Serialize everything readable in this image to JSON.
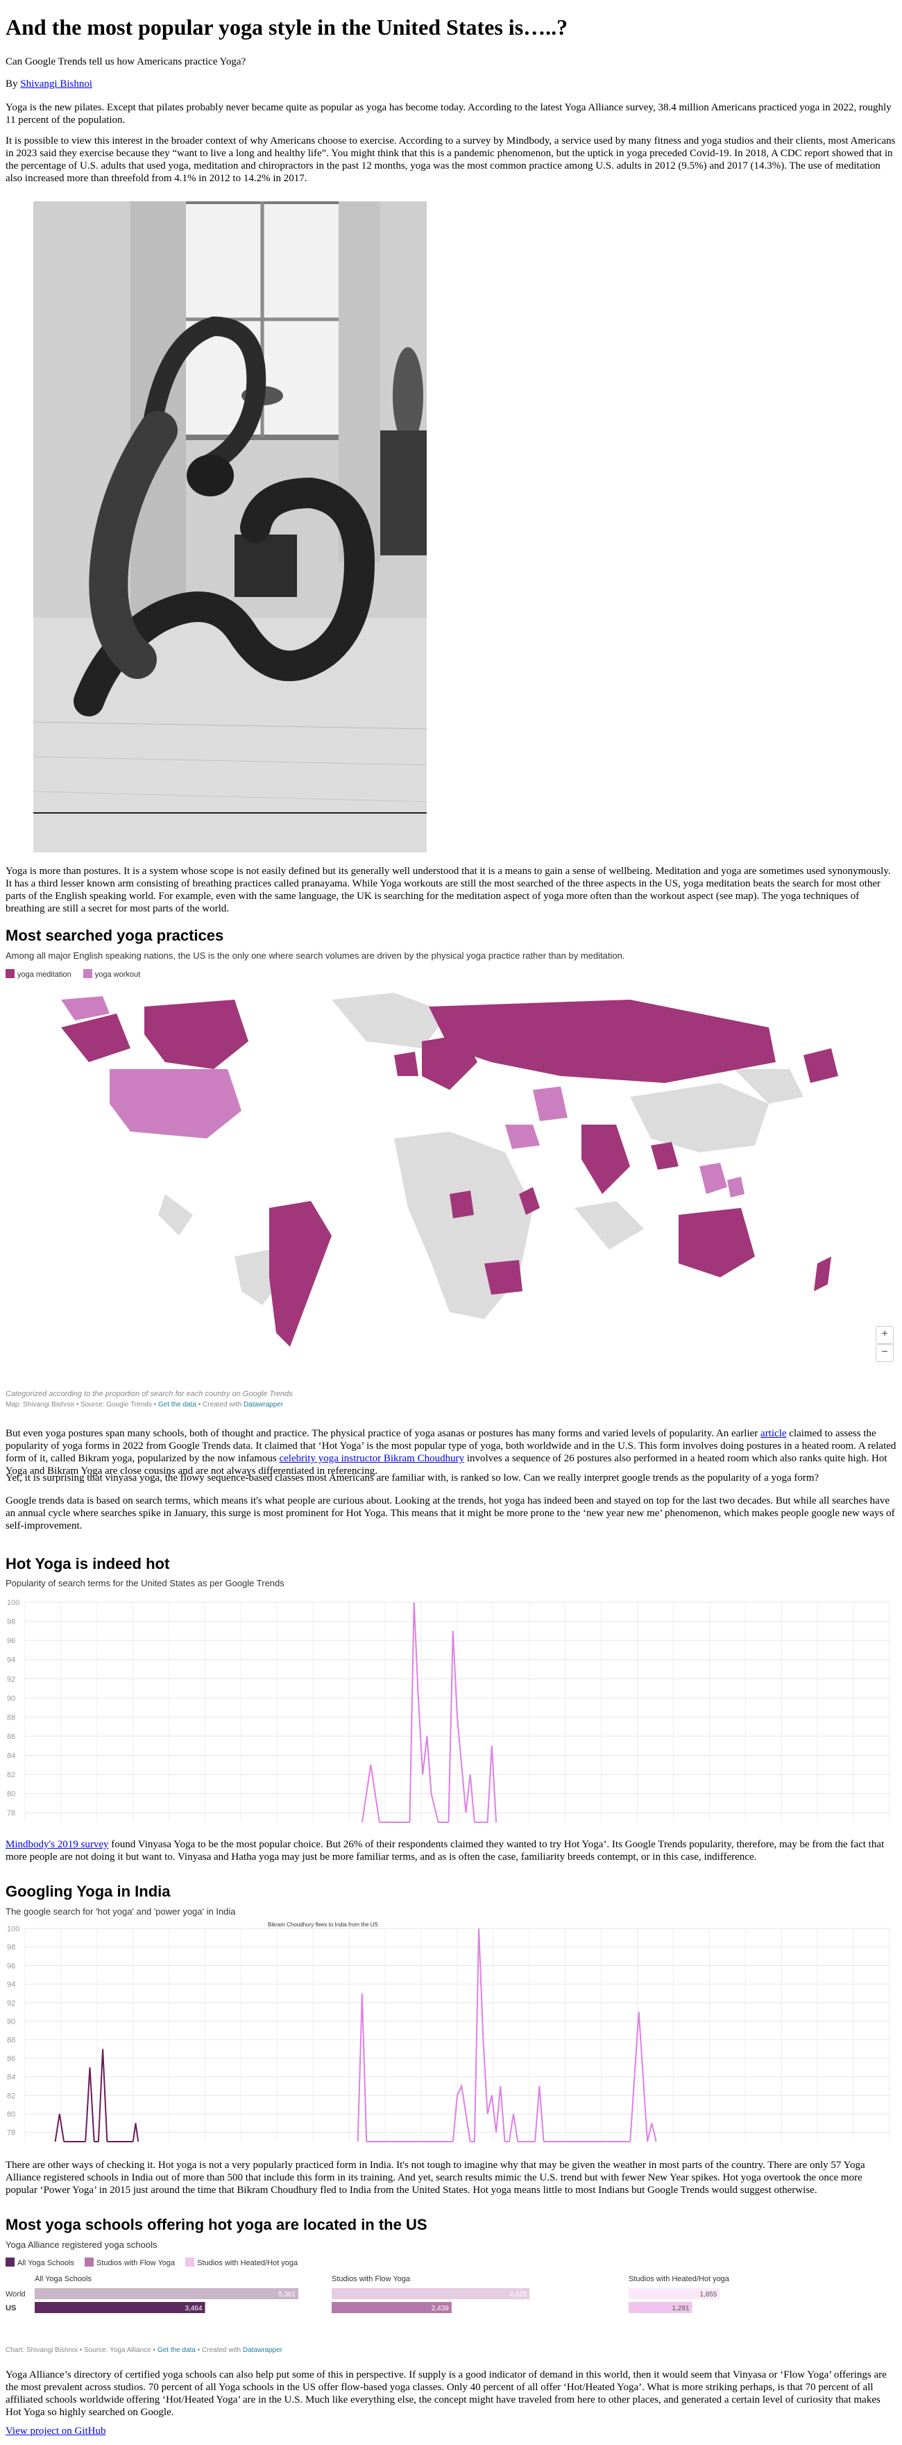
{
  "article": {
    "title": "And the most popular yoga style in the United States is…..?",
    "subtitle": "Can Google Trends tell us how Americans practice Yoga?",
    "byline_prefix": "By ",
    "author": "Shivangi Bishnoi",
    "para1": "Yoga is the new pilates. Except that pilates probably never became quite as popular as yoga has become today. According to the latest Yoga Alliance survey, 38.4 million Americans practiced yoga in 2022, roughly 11 percent of the population.",
    "para2": "It is possible to view this interest in the broader context of why Americans choose to exercise. According to a survey by Mindbody, a service used by many fitness and yoga studios and their clients, most Americans in 2023 said they exercise because they “want to live a long and healthy life”. You might think that this is a pandemic phenomenon, but the uptick in yoga preceded Covid-19. In 2018, A CDC report showed that in the percentage of U.S. adults that used yoga, meditation and chiropractors in the past 12 months, yoga was the most common practice among U.S. adults in 2012 (9.5%) and 2017 (14.3%). The use of meditation also increased more than threefold from 4.1% in 2012 to 14.2% in 2017.",
    "para3": "Yoga is more than postures. It is a system whose scope is not easily defined but its generally well understood that it is a means to gain a sense of wellbeing. Meditation and yoga are sometimes used synonymously. It has a third lesser known arm consisting of breathing practices called pranayama. While Yoga workouts are still the most searched of the three aspects in the US, yoga meditation beats the search for most other parts of the English speaking world. For example, even with the same language, the UK is searching for the meditation aspect of yoga more often than the workout aspect (see map). The yoga techniques of breathing are still a secret for most parts of the world.",
    "para4_a": "But even yoga postures span many schools, both of thought and practice. The physical practice of yoga asanas or postures has many forms and varied levels of popularity. An earlier ",
    "para4_link1": "article",
    "para4_b": " claimed to assess the popularity of yoga forms in 2022 from Google Trends data. It claimed that ‘Hot Yoga’ is the most popular type of yoga, both worldwide and in the U.S. This form involves doing postures in a heated room. A related form of it, called Bikram yoga, popularized by the now infamous ",
    "para4_link2": "celebrity yoga instructor Bikram Choudhury",
    "para4_c": " involves a sequence of 26 postures also performed in a heated room which also ranks quite high. Hot Yoga and Bikram Yoga are close cousins and are not always differentiated in referencing.",
    "para5": "Yet, it is surprising that vinyasa yoga, the flowy sequence-based classes most Americans are familiar with, is ranked so low. Can we really interpret google trends as the popularity of a yoga form?",
    "para6": "Google trends data is based on search terms, which means it's what people are curious about. Looking at the trends, hot yoga has indeed been and stayed on top for the last two decades. But while all searches have an annual cycle where searches spike in January, this surge is most prominent for Hot Yoga. This means that it might be more prone to the ‘new year new me’ phenomenon, which makes people google new ways of self-improvement.",
    "para7_link": "Mindbody's 2019 survey",
    "para7": " found Vinyasa Yoga to be the most popular choice. But 26% of their respondents claimed they wanted to try Hot Yoga’. Its Google Trends popularity, therefore, may be from the fact that more people are not doing it but want to. Vinyasa and Hatha yoga may just be more familiar terms, and as is often the case, familiarity breeds contempt, or in this case, indifference.",
    "para8": "There are other ways of checking it. Hot yoga is not a very popularly practiced form in India. It's not tough to imagine why that may be given the weather in most parts of the country. There are only 57 Yoga Alliance registered schools in India out of more than 500 that include this form in its training. And yet, search results mimic the U.S. trend but with fewer New Year spikes. Hot yoga overtook the once more popular ‘Power Yoga’ in 2015 just around the time that Bikram Choudhury fled to India from the United States. Hot yoga means little to most Indians but Google Trends would suggest otherwise.",
    "para9": "Yoga Alliance’s directory of certified yoga schools can also help put some of this in perspective. If supply is a good indicator of demand in this world, then it would seem that Vinyasa or ‘Flow Yoga’ offerings are the most prevalent across studios. 70 percent of all Yoga schools in the US offer flow-based yoga classes. Only 40 percent of all offer ‘Hot/Heated Yoga’. What is more striking perhaps, is that 70 percent of all affiliated schools worldwide offering ‘Hot/Heated Yoga’ are in the U.S. Much like everything else, the concept might have traveled from here to other places, and generated a certain level of curiosity that makes Hot Yoga so highly searched on Google.",
    "github_link": "View project on GitHub"
  },
  "map": {
    "heading": "Most searched yoga practices",
    "description": "Among all major English speaking nations, the US is the only one where search volumes are driven by the physical yoga practice rather than by meditation.",
    "legend": [
      {
        "label": "yoga meditation",
        "color": "#a2367a"
      },
      {
        "label": "yoga workout",
        "color": "#cc7fc0"
      }
    ],
    "zoom_in": "+",
    "zoom_out": "−",
    "caption": "Categorized according to the proportion of search for each country on Google Trends",
    "credit_prefix": "Map: Shivangi Bishnoi • Source: Google Trends • ",
    "credit_get_data": "Get the data",
    "credit_mid": " • Created with ",
    "credit_tool": "Datawrapper"
  },
  "chart_hot": {
    "heading": "Hot Yoga is indeed hot",
    "description": "Popularity of search terms for the United States as per Google Trends"
  },
  "chart_india": {
    "heading": "Googling Yoga in India",
    "description": "The google search for 'hot yoga' and 'power yoga' in India",
    "annotation": "Bikram Choudhury flees to India from the US"
  },
  "chart_schools": {
    "heading": "Most yoga schools offering hot yoga are located in the US",
    "description": "Yoga Alliance registered yoga schools",
    "legend": [
      {
        "label": "All Yoga Schools",
        "color": "#5c2a5e"
      },
      {
        "label": "Studios with Flow Yoga",
        "color": "#b477aa"
      },
      {
        "label": "Studios with Heated/Hot yoga",
        "color": "#f0c4ec"
      }
    ],
    "credit_prefix": "Chart: Shivangi Bishnoi • Source: Yoga Alliance • ",
    "credit_get_data": "Get the data",
    "credit_mid": " • Created with ",
    "credit_tool": "Datawrapper"
  },
  "chart_data": [
    {
      "type": "line",
      "title": "Hot Yoga is indeed hot",
      "ylim": [
        77,
        100
      ],
      "yticks": [
        78,
        80,
        82,
        84,
        86,
        88,
        90,
        92,
        94,
        96,
        98,
        100
      ],
      "xlabel": "",
      "ylabel": "",
      "series": [
        {
          "values": [
            [
              0.39,
              77
            ],
            [
              0.4,
              83
            ],
            [
              0.41,
              77
            ],
            [
              0.445,
              77
            ],
            [
              0.45,
              100
            ],
            [
              0.455,
              90
            ],
            [
              0.46,
              82
            ],
            [
              0.465,
              86
            ],
            [
              0.47,
              80
            ],
            [
              0.478,
              77
            ],
            [
              0.49,
              77
            ],
            [
              0.495,
              97
            ],
            [
              0.5,
              88
            ],
            [
              0.505,
              83
            ],
            [
              0.51,
              78
            ],
            [
              0.515,
              82
            ],
            [
              0.52,
              77
            ],
            [
              0.535,
              77
            ],
            [
              0.54,
              85
            ],
            [
              0.545,
              77
            ]
          ]
        }
      ],
      "grid": true
    },
    {
      "type": "line",
      "title": "Googling Yoga in India",
      "ylim": [
        77,
        100
      ],
      "yticks": [
        78,
        80,
        82,
        84,
        86,
        88,
        90,
        92,
        94,
        96,
        98,
        100
      ],
      "series": [
        {
          "color": "#6b1a5c",
          "values": [
            [
              0.035,
              77
            ],
            [
              0.04,
              80
            ],
            [
              0.045,
              77
            ],
            [
              0.07,
              77
            ],
            [
              0.075,
              85
            ],
            [
              0.08,
              77
            ],
            [
              0.085,
              77
            ],
            [
              0.09,
              87
            ],
            [
              0.095,
              77
            ],
            [
              0.125,
              77
            ],
            [
              0.128,
              79
            ],
            [
              0.131,
              77
            ]
          ]
        },
        {
          "color": "#e07fe6",
          "values": [
            [
              0.385,
              77
            ],
            [
              0.39,
              93
            ],
            [
              0.395,
              77
            ],
            [
              0.495,
              77
            ],
            [
              0.5,
              82
            ],
            [
              0.505,
              83
            ],
            [
              0.51,
              80
            ],
            [
              0.515,
              77
            ],
            [
              0.52,
              77
            ],
            [
              0.525,
              100
            ],
            [
              0.53,
              88
            ],
            [
              0.535,
              80
            ],
            [
              0.54,
              82
            ],
            [
              0.545,
              78
            ],
            [
              0.55,
              83
            ],
            [
              0.555,
              77
            ],
            [
              0.56,
              77
            ],
            [
              0.565,
              80
            ],
            [
              0.57,
              77
            ],
            [
              0.59,
              77
            ],
            [
              0.595,
              83
            ],
            [
              0.6,
              77
            ],
            [
              0.7,
              77
            ],
            [
              0.71,
              91
            ],
            [
              0.715,
              84
            ],
            [
              0.72,
              77
            ],
            [
              0.725,
              79
            ],
            [
              0.73,
              77
            ]
          ]
        }
      ],
      "grid": true
    },
    {
      "type": "bar",
      "title": "Most yoga schools offering hot yoga are located in the US",
      "categories": [
        "World",
        "US"
      ],
      "columns": [
        "All Yoga Schools",
        "Studios with Flow Yoga",
        "Studios with Heated/Hot yoga"
      ],
      "series": [
        {
          "name": "All Yoga Schools",
          "values": [
            5361,
            3464
          ]
        },
        {
          "name": "Studios with Flow Yoga",
          "values": [
            4025,
            2439
          ]
        },
        {
          "name": "Studios with Heated/Hot yoga",
          "values": [
            1855,
            1291
          ]
        }
      ],
      "value_labels": {
        "World": [
          "5,361",
          "4,025",
          "1,855"
        ],
        "US": [
          "3,464",
          "2,439",
          "1,291"
        ]
      }
    }
  ]
}
